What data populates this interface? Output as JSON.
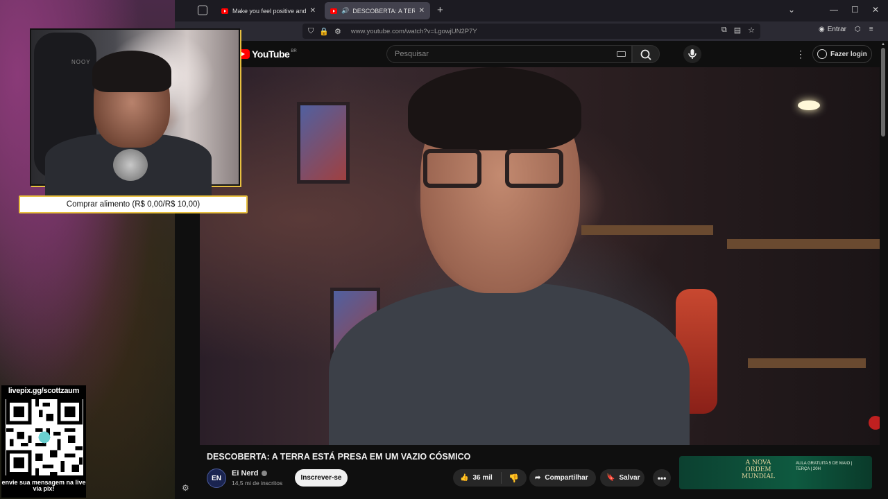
{
  "browser": {
    "tabs": [
      {
        "title": "Make you feel positive and pe...",
        "active": false
      },
      {
        "title": "DESCOBERTA: A TERRA ESTÁ...",
        "active": true
      }
    ],
    "url": "www.youtube.com/watch?v=LgowjUN2P7Y",
    "signin_label": "Entrar"
  },
  "youtube": {
    "logo_text": "YouTube",
    "country_code": "BR",
    "search_placeholder": "Pesquisar",
    "login_label": "Fazer login",
    "video_title": "DESCOBERTA: A TERRA ESTÁ PRESA EM UM VAZIO CÓSMICO",
    "channel_name": "Ei Nerd",
    "channel_subs": "14,5 mi de inscritos",
    "subscribe_label": "Inscrever-se",
    "like_count": "36 mil",
    "share_label": "Compartilhar",
    "save_label": "Salvar",
    "ad": {
      "title": "A NOVA ORDEM MUNDIAL",
      "text": "AULA GRATUITA 5 DE MAIO | TERÇA | 20H"
    }
  },
  "overlay": {
    "buy_label": "Comprar alimento (R$ 0,00/R$ 10,00)",
    "livepix_url": "livepix.gg/scottzaum",
    "livepix_msg": "envie sua mensagem na live via pix!",
    "webcam_chair_brand": "NOOY"
  },
  "colors": {
    "accent_gold": "#e8c040",
    "youtube_red": "#ff0000",
    "ad_green": "#0e5a40"
  }
}
